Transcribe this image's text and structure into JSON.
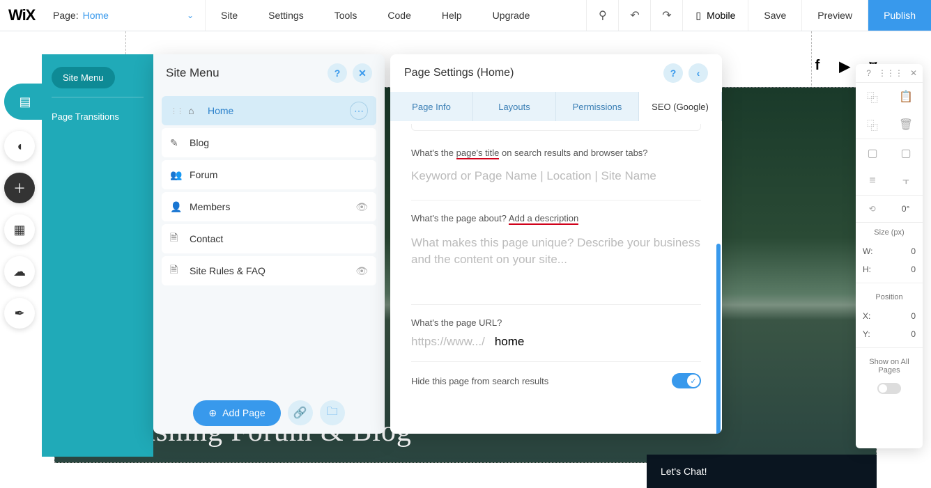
{
  "topbar": {
    "logo": "WiX",
    "page_label": "Page:",
    "page_name": "Home",
    "menu": [
      "Site",
      "Settings",
      "Tools",
      "Code",
      "Help",
      "Upgrade"
    ],
    "mobile": "Mobile",
    "save": "Save",
    "preview": "Preview",
    "publish": "Publish"
  },
  "leftbar": {
    "items": [
      "pages",
      "add",
      "apps",
      "media",
      "upload",
      "blog"
    ]
  },
  "teal": {
    "active": "Site Menu",
    "item1": "Page Transitions"
  },
  "site_menu": {
    "title": "Site Menu",
    "items": [
      {
        "icon": "⌂",
        "label": "Home",
        "selected": true,
        "more": true
      },
      {
        "icon": "✎",
        "label": "Blog"
      },
      {
        "icon": "👥",
        "label": "Forum"
      },
      {
        "icon": "👤",
        "label": "Members",
        "hidden": true
      },
      {
        "icon": "🗎",
        "label": "Contact"
      },
      {
        "icon": "🗎",
        "label": "Site Rules & FAQ",
        "hidden": true
      }
    ],
    "add_page": "Add Page"
  },
  "settings": {
    "title": "Page Settings (Home)",
    "tabs": [
      "Page Info",
      "Layouts",
      "Permissions",
      "SEO (Google)"
    ],
    "title_q_pre": "What's the ",
    "title_q_u": "page's title",
    "title_q_post": " on search results and browser tabs?",
    "title_ph": "Keyword or Page Name | Location | Site Name",
    "desc_q_pre": "What's the page about? ",
    "desc_q_u": "Add a description",
    "desc_ph": "What makes this page unique? Describe your business and the content on your site...",
    "url_q": "What's the page URL?",
    "url_pre": "https://www.../",
    "url_val": "home",
    "hide_q": "Hide this page from search results"
  },
  "right": {
    "deg": "0°",
    "size_h": "Size (px)",
    "w_l": "W:",
    "w_v": "0",
    "h_l": "H:",
    "h_v": "0",
    "pos_h": "Position",
    "x_l": "X:",
    "x_v": "0",
    "y_l": "Y:",
    "y_v": "0",
    "show": "Show on All Pages"
  },
  "hero": {
    "title": "Fishing Forum & Blog"
  },
  "chat": "Let's Chat!"
}
